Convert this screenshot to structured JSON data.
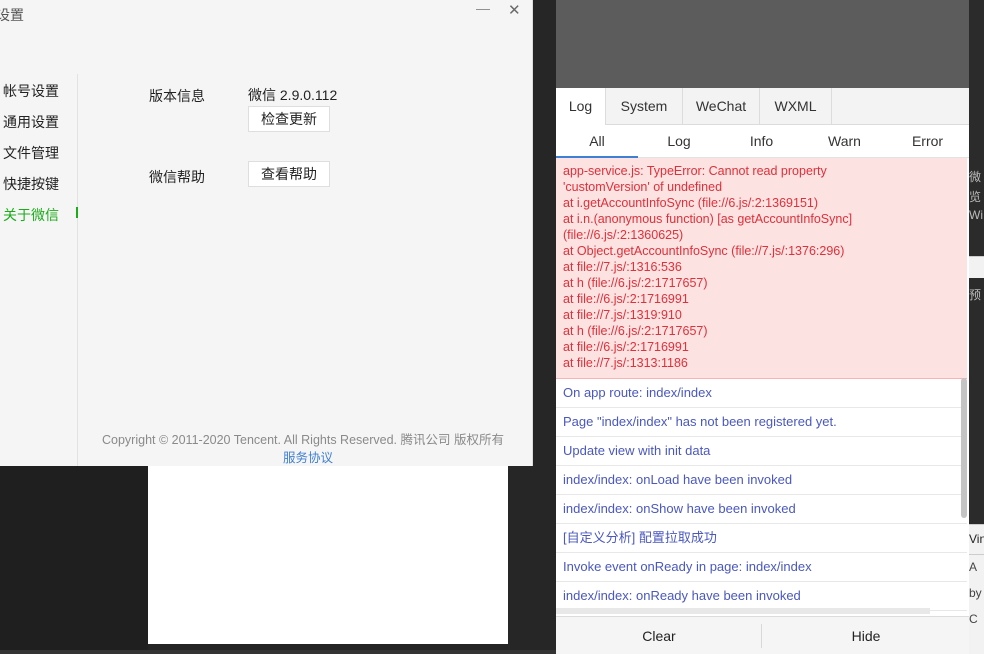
{
  "settings": {
    "title": "设置",
    "minimize_glyph": "—",
    "close_glyph": "✕",
    "nav": [
      {
        "label": "帐号设置",
        "active": false
      },
      {
        "label": "通用设置",
        "active": false
      },
      {
        "label": "文件管理",
        "active": false
      },
      {
        "label": "快捷按键",
        "active": false
      },
      {
        "label": "关于微信",
        "active": true
      }
    ],
    "version_label": "版本信息",
    "version_value": "微信 2.9.0.112",
    "check_update": "检查更新",
    "help_label": "微信帮助",
    "view_help": "查看帮助",
    "copyright": "Copyright © 2011-2020 Tencent. All Rights Reserved. 腾讯公司 版权所有",
    "service_link": "服务协议",
    "accent_color": "#1aad19"
  },
  "console": {
    "tabs": [
      "Log",
      "System",
      "WeChat",
      "WXML"
    ],
    "active_tab": "Log",
    "filters": [
      "All",
      "Log",
      "Info",
      "Warn",
      "Error"
    ],
    "active_filter": "All",
    "error_lines": [
      "app-service.js: TypeError: Cannot read property",
      "'customVersion' of undefined",
      "at i.getAccountInfoSync (file://6.js/:2:1369151)",
      "at i.n.(anonymous function) [as getAccountInfoSync]",
      "(file://6.js/:2:1360625)",
      "at Object.getAccountInfoSync (file://7.js/:1376:296)",
      "at file://7.js/:1316:536",
      "at h (file://6.js/:2:1717657)",
      "at file://6.js/:2:1716991",
      "at file://7.js/:1319:910",
      "at h (file://6.js/:2:1717657)",
      "at file://6.js/:2:1716991",
      "at file://7.js/:1313:1186"
    ],
    "log_lines": [
      "On app route: index/index",
      "Page \"index/index\" has not been registered yet.",
      "Update view with init data",
      "index/index: onLoad have been invoked",
      "index/index: onShow have been invoked",
      "[自定义分析] 配置拉取成功",
      "Invoke event onReady in page: index/index",
      "index/index: onReady have been invoked"
    ],
    "clear_label": "Clear",
    "hide_label": "Hide",
    "error_color": "#e0303a",
    "log_color": "#4a58bf"
  },
  "right_edge": {
    "texts": [
      "微",
      "览",
      "Wi",
      "预",
      "Vin",
      "A",
      "by",
      "C"
    ]
  }
}
